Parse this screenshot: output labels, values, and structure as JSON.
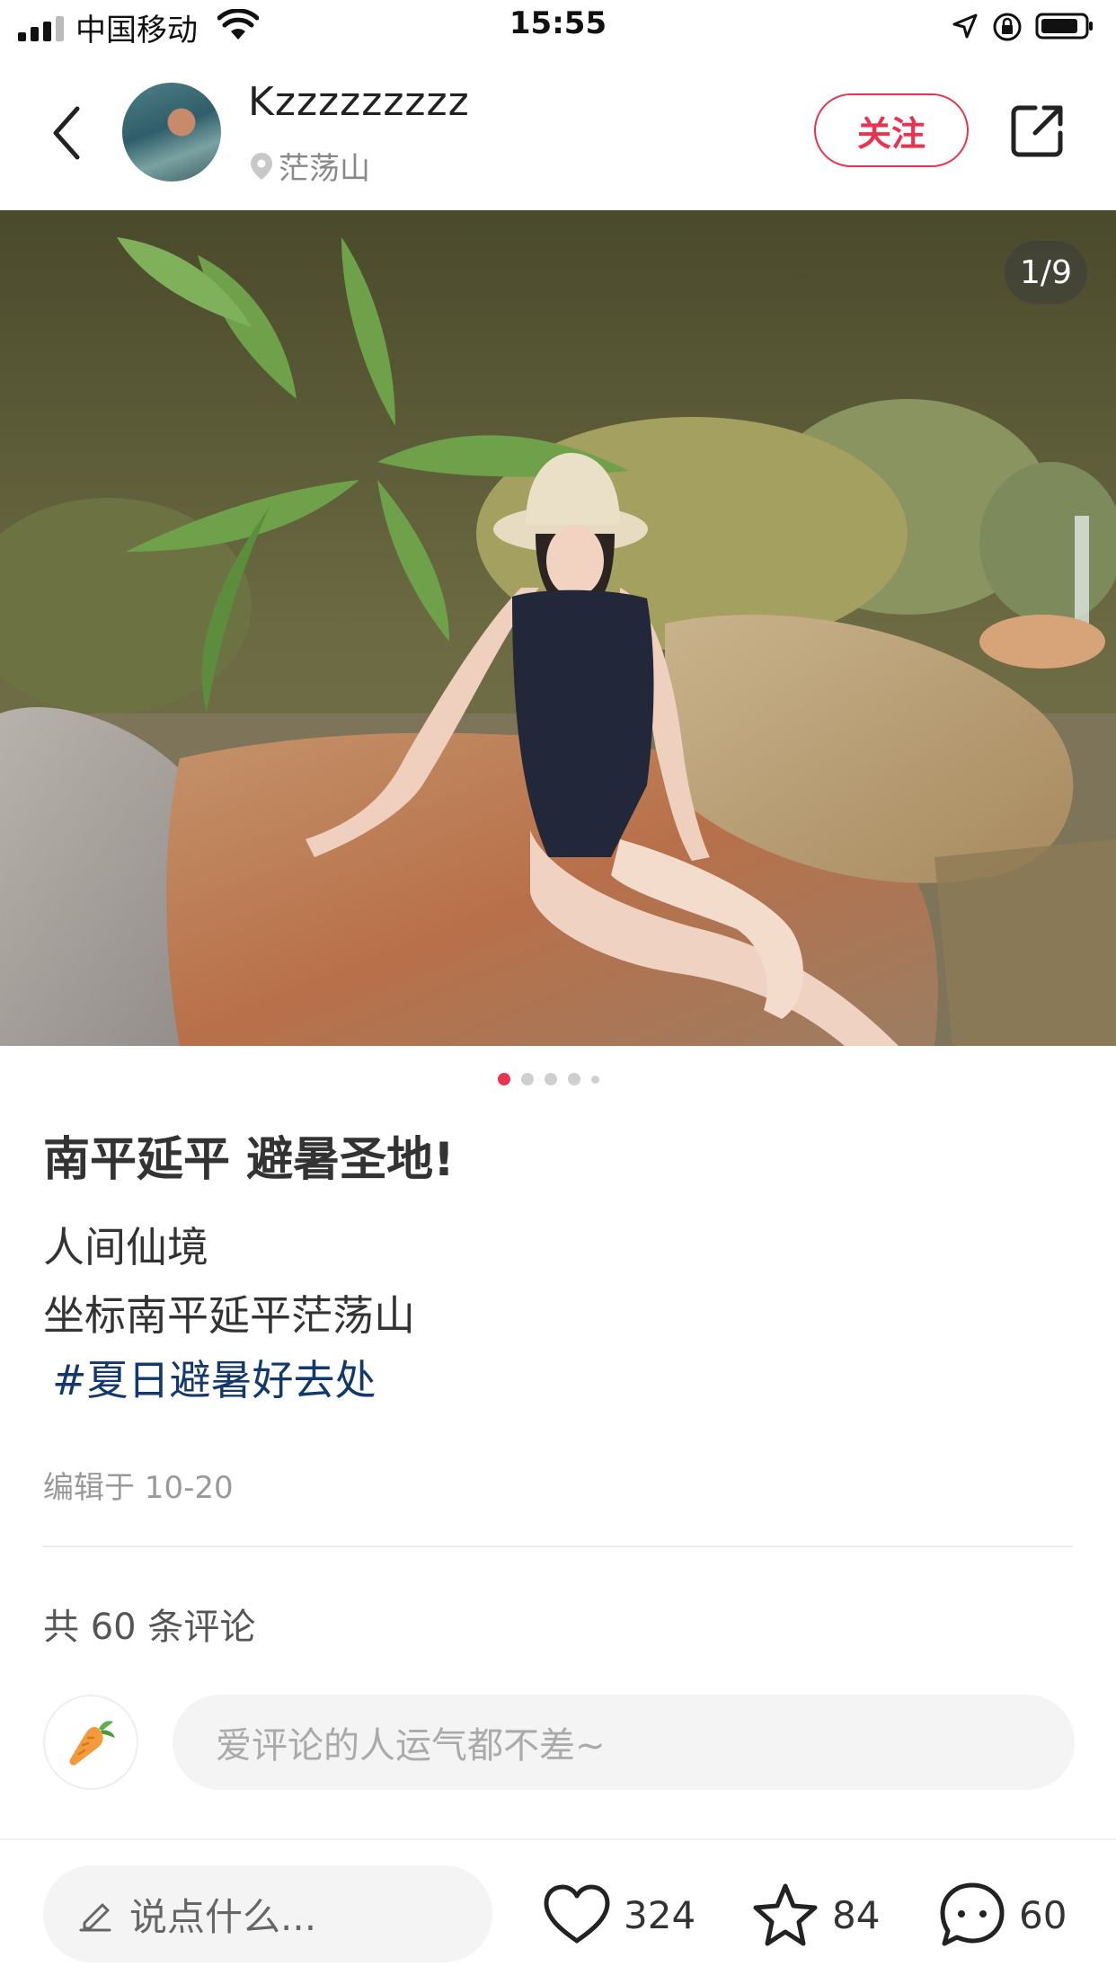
{
  "status_bar": {
    "carrier": "中国移动",
    "time": "15:55"
  },
  "header": {
    "username": "Kzzzzzzzzz",
    "location": "茫荡山",
    "follow_label": "关注"
  },
  "photo": {
    "page_indicator": "1/9",
    "total_dots": 5,
    "active_dot": 1
  },
  "post": {
    "title": "南平延平 避暑圣地!",
    "lines": [
      "人间仙境",
      "坐标南平延平茫荡山"
    ],
    "hashtag": "#夏日避暑好去处",
    "edit_time": "编辑于 10-20"
  },
  "comments": {
    "count_label": "共 60 条评论",
    "input_placeholder": "爱评论的人运气都不差~"
  },
  "bottom_bar": {
    "say_placeholder": "说点什么...",
    "likes": "324",
    "favorites": "84",
    "comments": "60"
  },
  "colors": {
    "accent": "#e8344e",
    "hashtag": "#13386c"
  }
}
